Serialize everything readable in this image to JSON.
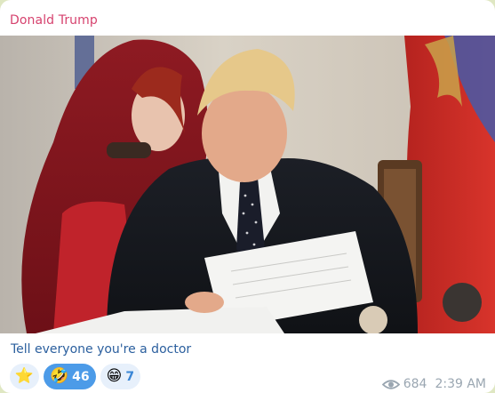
{
  "message": {
    "sender": "Donald Trump",
    "caption": "Tell everyone you're a doctor",
    "views": "684",
    "time": "2:39 AM"
  },
  "reactions": [
    {
      "emoji": "⭐",
      "count": "",
      "active": false,
      "icon": "star-reaction-icon"
    },
    {
      "emoji": "🤣",
      "count": "46",
      "active": true,
      "icon": "rofl-reaction-icon"
    },
    {
      "emoji": "😁",
      "count": "7",
      "active": false,
      "icon": "grin-reaction-icon"
    }
  ],
  "colors": {
    "sender": "#d6426e",
    "caption": "#2b5f9e",
    "active_reaction": "#4c9be8",
    "meta": "#9aa6b1"
  },
  "icons": {
    "views": "eye-icon"
  }
}
